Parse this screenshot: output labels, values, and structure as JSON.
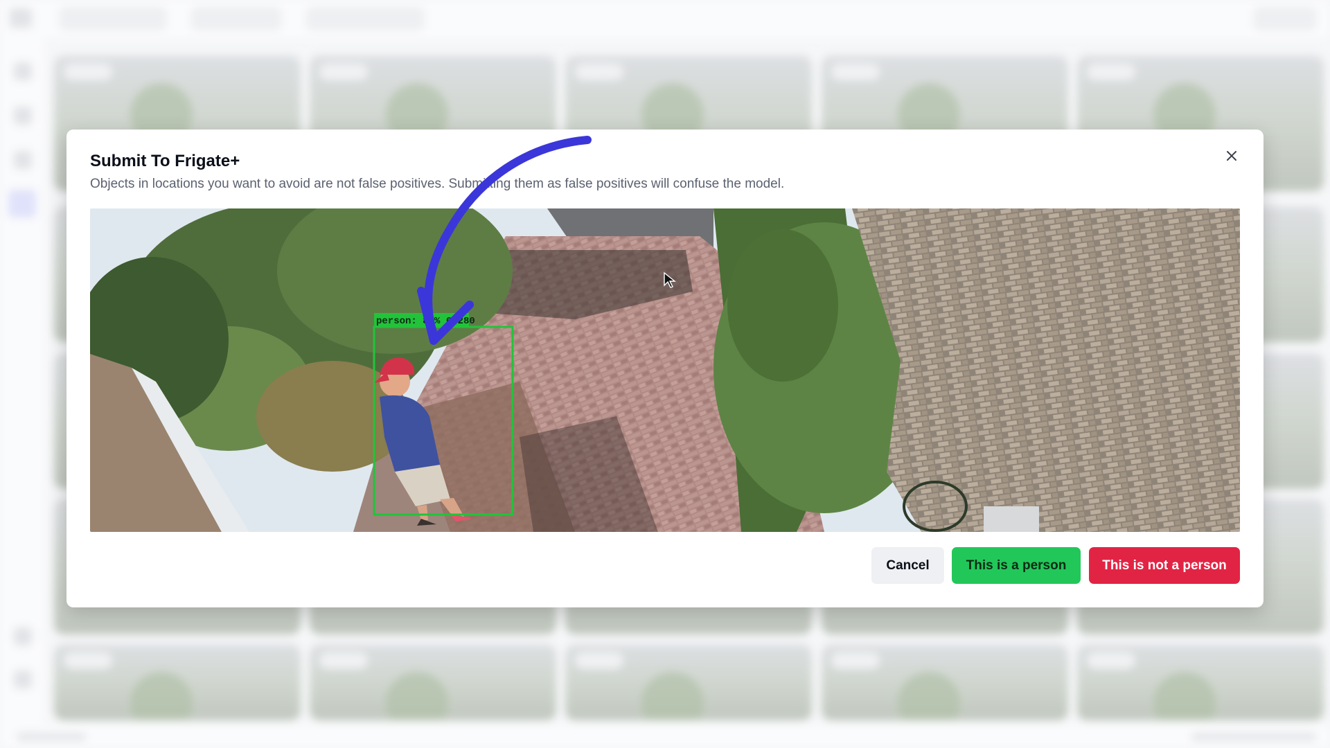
{
  "dialog": {
    "title": "Submit To Frigate+",
    "description": "Objects in locations you want to avoid are not false positives. Submitting them as false positives will confuse the model.",
    "close_icon": "close-icon"
  },
  "snapshot": {
    "detection_label": "person: 82% 67280"
  },
  "actions": {
    "cancel_label": "Cancel",
    "confirm_label": "This is a person",
    "reject_label": "This is not a person"
  },
  "colors": {
    "confirm": "#22c75a",
    "reject": "#e22444",
    "detection_box": "#22c33a",
    "annotation_arrow": "#3b36d9"
  }
}
